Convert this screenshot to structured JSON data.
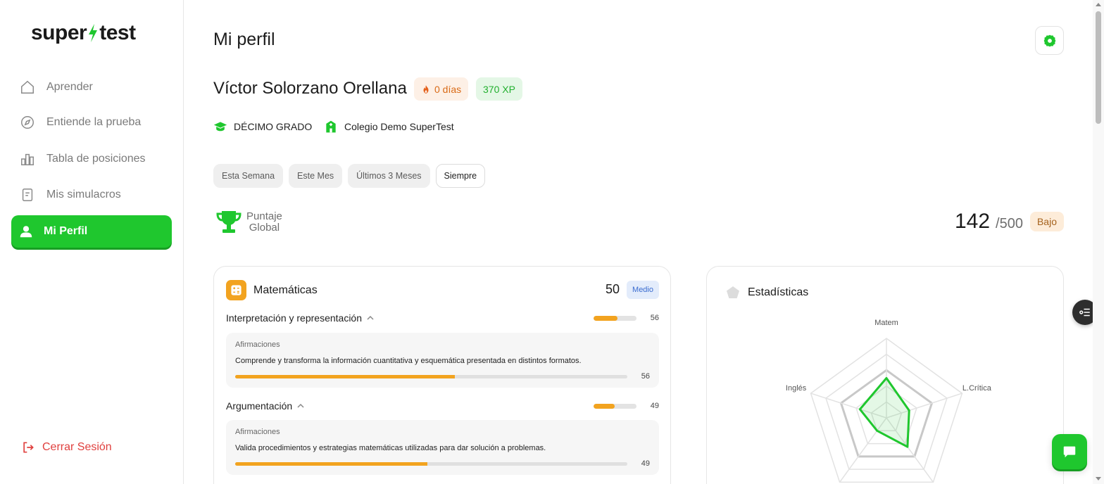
{
  "brand": {
    "logo_left": "super",
    "logo_right": "test",
    "accent": "#1fc72e"
  },
  "sidebar": {
    "items": [
      {
        "label": "Aprender",
        "icon": "home-icon",
        "active": false
      },
      {
        "label": "Entiende la prueba",
        "icon": "compass-icon",
        "active": false
      },
      {
        "label": "Tabla de posiciones",
        "icon": "leaderboard-icon",
        "active": false
      },
      {
        "label": "Mis simulacros",
        "icon": "document-icon",
        "active": false
      },
      {
        "label": "Mi Perfil",
        "icon": "user-icon",
        "active": true
      }
    ],
    "logout_label": "Cerrar Sesión"
  },
  "header": {
    "title": "Mi perfil"
  },
  "profile": {
    "name": "Víctor Solorzano Orellana",
    "streak": "0 días",
    "xp": "370 XP",
    "grade": "DÉCIMO GRADO",
    "school": "Colegio Demo SuperTest"
  },
  "filters": [
    {
      "label": "Esta Semana",
      "active": false
    },
    {
      "label": "Este Mes",
      "active": false
    },
    {
      "label": "Últimos 3 Meses",
      "active": false
    },
    {
      "label": "Siempre",
      "active": true
    }
  ],
  "global_score": {
    "label_line1": "Puntaje",
    "label_line2": "Global",
    "value": "142",
    "max": "/500",
    "level": "Bajo"
  },
  "math_card": {
    "title": "Matemáticas",
    "score": "50",
    "level": "Medio",
    "competencies": [
      {
        "name": "Interpretación y representación",
        "value": 56,
        "value_label": "56",
        "affirmation_label": "Afirmaciones",
        "affirmation_text": "Comprende y transforma la información cuantitativa y esquemática presentada en distintos formatos.",
        "affirmation_value": 56,
        "affirmation_value_label": "56"
      },
      {
        "name": "Argumentación",
        "value": 49,
        "value_label": "49",
        "affirmation_label": "Afirmaciones",
        "affirmation_text": "Valida procedimientos y estrategias matemáticas utilizadas para dar solución a problemas.",
        "affirmation_value": 49,
        "affirmation_value_label": "49"
      }
    ]
  },
  "stats_card": {
    "title": "Estadísticas",
    "axes": [
      "Matem",
      "L.Crítica",
      "",
      "",
      "Inglés"
    ],
    "values": [
      50,
      30,
      45,
      20,
      35
    ],
    "max": 100,
    "series_color": "#1fc72e"
  }
}
